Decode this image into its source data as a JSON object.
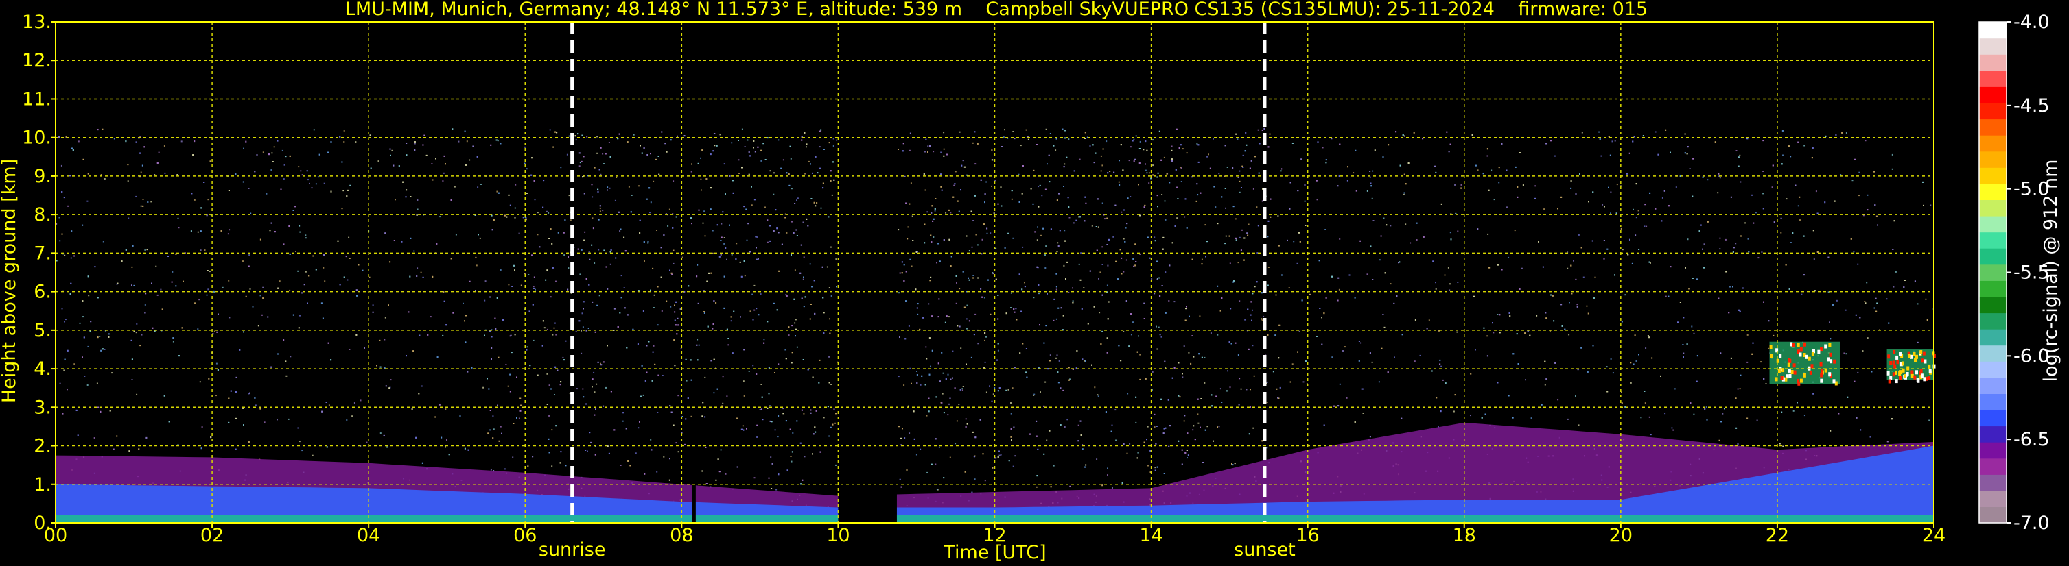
{
  "chart_data": {
    "type": "heatmap",
    "title": "LMU-MIM, Munich, Germany; 48.148° N 11.573° E, altitude: 539 m    Campbell SkyVUEPRO CS135 (CS135LMU): 25-11-2024    firmware: 015",
    "xlabel": "Time [UTC]",
    "ylabel": "Height above ground [km]",
    "xlim": [
      0,
      24
    ],
    "ylim": [
      0,
      13
    ],
    "x_ticks": [
      "00",
      "02",
      "04",
      "06",
      "08",
      "10",
      "12",
      "14",
      "16",
      "18",
      "20",
      "22",
      "24"
    ],
    "y_ticks": [
      "0.",
      "1.",
      "2.",
      "3.",
      "4.",
      "5.",
      "6.",
      "7.",
      "8.",
      "9.",
      "10.",
      "11.",
      "12.",
      "13."
    ],
    "grid": true,
    "colorbar": {
      "label": "log(rc-signal) @ 912 nm",
      "min": -7.0,
      "max": -4.0,
      "ticks": [
        "-4.0",
        "-4.5",
        "-5.0",
        "-5.5",
        "-6.0",
        "-6.5",
        "-7.0"
      ],
      "colors": [
        "#a08898",
        "#b090a8",
        "#8a5aa0",
        "#9a2aa0",
        "#7a10a0",
        "#4020c0",
        "#3050ff",
        "#6080ff",
        "#8aa0ff",
        "#a8c0ff",
        "#9ad0e0",
        "#3ab0a0",
        "#20a060",
        "#108010",
        "#30b030",
        "#60c860",
        "#20c080",
        "#40e0a0",
        "#a0f0b0",
        "#c8f060",
        "#ffff20",
        "#ffd000",
        "#ffb000",
        "#ff9000",
        "#ff6000",
        "#ff2000",
        "#ff0000",
        "#ff5050",
        "#f0b0b0",
        "#e8d8d8",
        "#ffffff"
      ]
    },
    "annotations": [
      {
        "label": "sunrise",
        "x": 6.6
      },
      {
        "label": "sunset",
        "x": 15.45
      }
    ],
    "data_gaps": [
      [
        8.13,
        8.18
      ],
      [
        10.0,
        10.75
      ]
    ],
    "signal_top_km": 10.25,
    "layers": [
      {
        "name": "boundary layer (blue)",
        "x": [
          0,
          2,
          4,
          6,
          8,
          10,
          12,
          14,
          16,
          18,
          20,
          22,
          24
        ],
        "top_km": [
          1.0,
          0.95,
          0.9,
          0.75,
          0.55,
          0.4,
          0.4,
          0.45,
          0.55,
          0.6,
          0.6,
          1.3,
          2.0
        ]
      },
      {
        "name": "aerosol layer (purple)",
        "x": [
          0,
          2,
          4,
          6,
          8,
          10,
          12,
          14,
          16,
          18,
          20,
          22,
          24
        ],
        "top_km": [
          1.75,
          1.7,
          1.55,
          1.3,
          1.0,
          0.7,
          0.8,
          0.9,
          1.9,
          2.6,
          2.3,
          1.9,
          2.1
        ]
      },
      {
        "name": "cloud",
        "x_range": [
          21.9,
          22.8
        ],
        "height_km": [
          3.6,
          4.7
        ]
      },
      {
        "name": "cloud",
        "x_range": [
          23.4,
          24
        ],
        "height_km": [
          3.7,
          4.5
        ]
      }
    ]
  }
}
